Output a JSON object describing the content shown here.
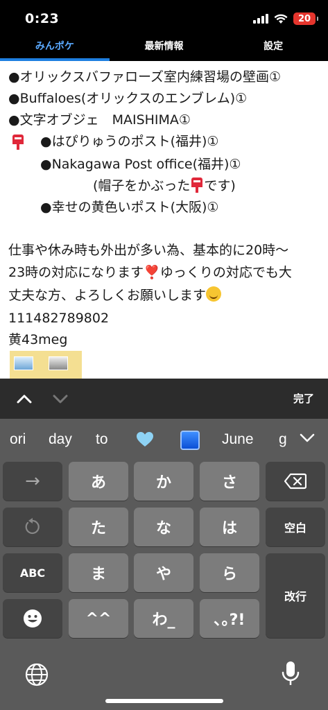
{
  "status_bar": {
    "time": "0:23",
    "battery": "20",
    "battery_color": "#e5352d"
  },
  "tabs": [
    {
      "label": "みんポケ",
      "active": true
    },
    {
      "label": "最新情報",
      "active": false
    },
    {
      "label": "設定",
      "active": false
    }
  ],
  "content": {
    "lines": [
      "●オリックスバファローズ室内練習場の壁画①",
      "●Buffaloes(オリックスのエンブレム)①",
      "●文字オブジェ　MAISHIMA①",
      "●はぴりゅうのポスト(福井)①",
      "●Nakagawa Post office(福井)①",
      "(帽子をかぶった",
      "です)",
      "●幸せの黄色いポスト(大阪)①",
      "仕事や休み時も外出が多い為、基本的に20時〜",
      "23時の対応になります",
      "ゆっくりの対応でも大",
      "丈夫な方、よろしくお願いします",
      "111482789802",
      "黄43meg"
    ],
    "heart_emoji": "❣️"
  },
  "toolbar": {
    "up_icon": "chevron-up-icon",
    "down_icon": "chevron-down-icon",
    "done_label": "完了"
  },
  "suggestions": [
    "ori",
    "day",
    "to",
    "June",
    "g"
  ],
  "keys": {
    "row1": [
      "→",
      "あ",
      "か",
      "さ"
    ],
    "row2": [
      "た",
      "な",
      "は"
    ],
    "space": "空白",
    "row3_left": "ABC",
    "row3": [
      "ま",
      "や",
      "ら"
    ],
    "enter": "改行",
    "row4": [
      "^^",
      "わ_",
      "､｡?!"
    ]
  },
  "colors": {
    "accent": "#1e7fe0",
    "tab_active": "#5aa9ff"
  }
}
